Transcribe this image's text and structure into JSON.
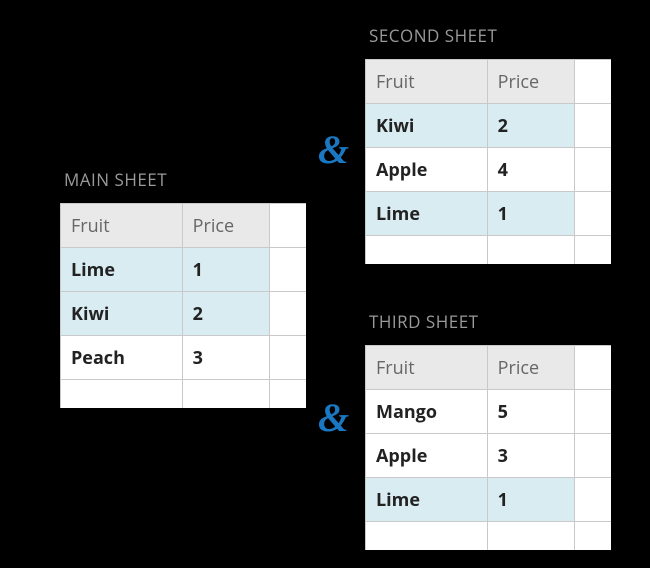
{
  "connectors": {
    "amp1": "&",
    "amp2": "&"
  },
  "sheets": {
    "main": {
      "title": "MAIN SHEET",
      "columns": [
        "Fruit",
        "Price"
      ],
      "rows": [
        {
          "fruit": "Lime",
          "price": "1",
          "highlight": true
        },
        {
          "fruit": "Kiwi",
          "price": "2",
          "highlight": true
        },
        {
          "fruit": "Peach",
          "price": "3",
          "highlight": false
        }
      ]
    },
    "second": {
      "title": "SECOND SHEET",
      "columns": [
        "Fruit",
        "Price"
      ],
      "rows": [
        {
          "fruit": "Kiwi",
          "price": "2",
          "highlight": true
        },
        {
          "fruit": "Apple",
          "price": "4",
          "highlight": false
        },
        {
          "fruit": "Lime",
          "price": "1",
          "highlight": true
        }
      ]
    },
    "third": {
      "title": "THIRD SHEET",
      "columns": [
        "Fruit",
        "Price"
      ],
      "rows": [
        {
          "fruit": "Mango",
          "price": "5",
          "highlight": false
        },
        {
          "fruit": "Apple",
          "price": "3",
          "highlight": false
        },
        {
          "fruit": "Lime",
          "price": "1",
          "highlight": true
        }
      ]
    }
  }
}
